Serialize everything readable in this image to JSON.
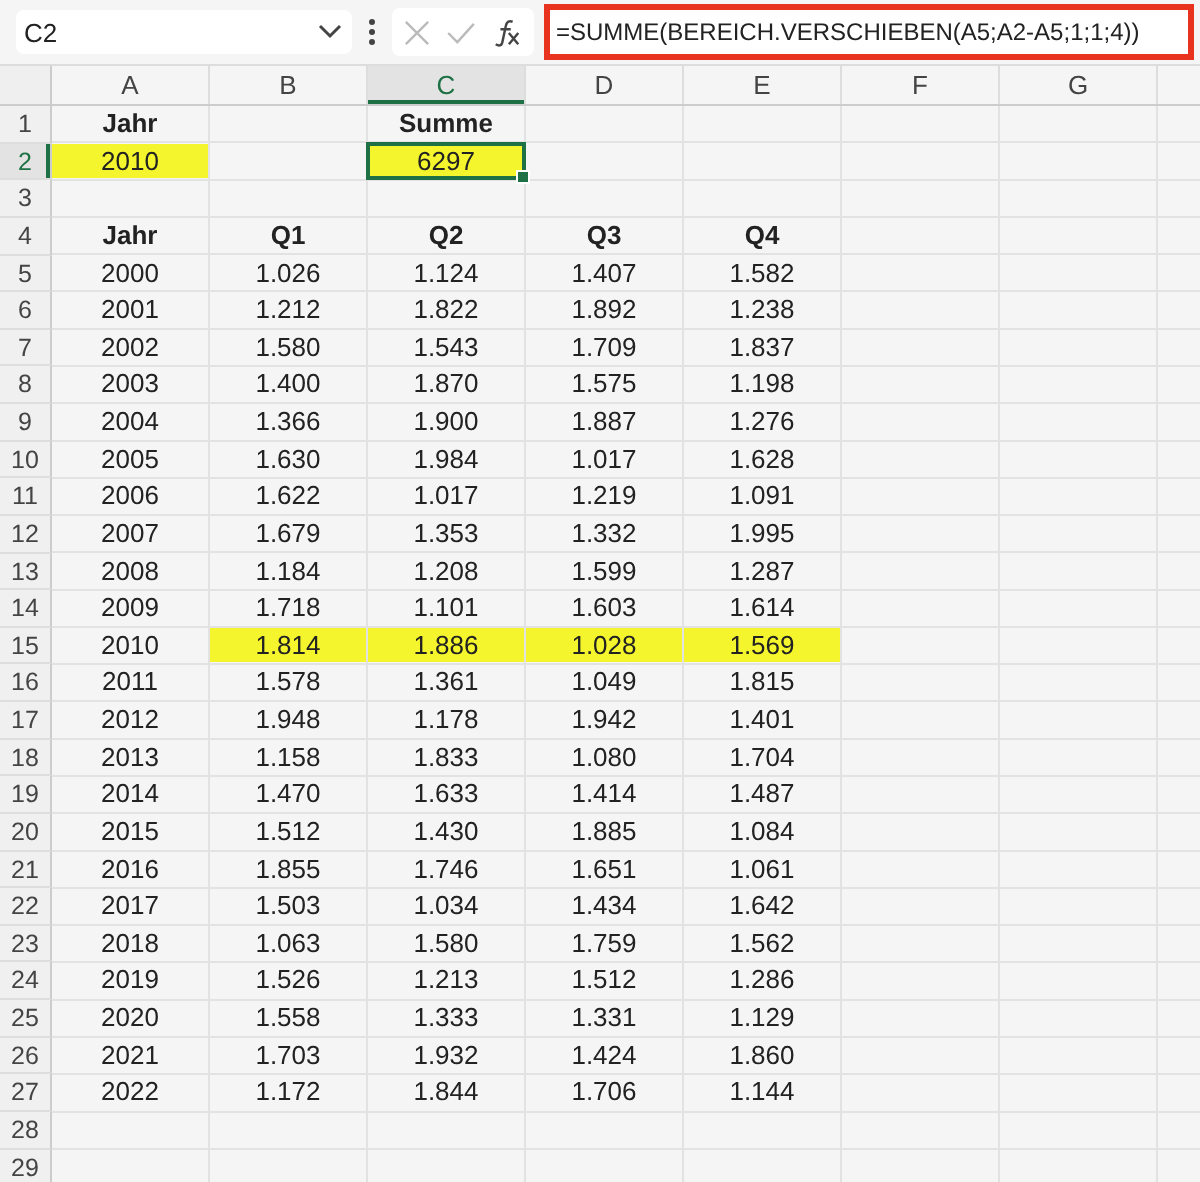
{
  "formula_bar": {
    "name_box": "C2",
    "formula": "=SUMME(BEREICH.VERSCHIEBEN(A5;A2-A5;1;1;4))",
    "outlined": true
  },
  "columns": [
    {
      "label": "A",
      "selected": false
    },
    {
      "label": "B",
      "selected": false
    },
    {
      "label": "C",
      "selected": true
    },
    {
      "label": "D",
      "selected": false
    },
    {
      "label": "E",
      "selected": false
    },
    {
      "label": "F",
      "selected": false
    },
    {
      "label": "G",
      "selected": false
    }
  ],
  "rows": [
    {
      "number": "1",
      "selected": false,
      "cells": [
        {
          "text": "Jahr",
          "bold": true,
          "highlighted": false,
          "selected": false
        },
        null,
        {
          "text": "Summe",
          "bold": true,
          "highlighted": false,
          "selected": false
        }
      ]
    },
    {
      "number": "2",
      "selected": true,
      "cells": [
        {
          "text": "2010",
          "bold": false,
          "highlighted": true,
          "selected": false
        },
        null,
        {
          "text": "6297",
          "bold": false,
          "highlighted": true,
          "selected": true
        }
      ]
    },
    {
      "number": "3",
      "selected": false
    },
    {
      "number": "4",
      "selected": false,
      "cells": [
        {
          "text": "Jahr",
          "bold": true,
          "highlighted": false,
          "selected": false
        },
        {
          "text": "Q1",
          "bold": true,
          "highlighted": false,
          "selected": false
        },
        {
          "text": "Q2",
          "bold": true,
          "highlighted": false,
          "selected": false
        },
        {
          "text": "Q3",
          "bold": true,
          "highlighted": false,
          "selected": false
        },
        {
          "text": "Q4",
          "bold": true,
          "highlighted": false,
          "selected": false
        }
      ]
    },
    {
      "number": "5",
      "selected": false,
      "cells": [
        {
          "text": "2000",
          "bold": false,
          "highlighted": false,
          "selected": false
        },
        {
          "text": "1.026",
          "bold": false,
          "highlighted": false,
          "selected": false
        },
        {
          "text": "1.124",
          "bold": false,
          "highlighted": false,
          "selected": false
        },
        {
          "text": "1.407",
          "bold": false,
          "highlighted": false,
          "selected": false
        },
        {
          "text": "1.582",
          "bold": false,
          "highlighted": false,
          "selected": false
        }
      ]
    },
    {
      "number": "6",
      "selected": false,
      "cells": [
        {
          "text": "2001",
          "bold": false,
          "highlighted": false,
          "selected": false
        },
        {
          "text": "1.212",
          "bold": false,
          "highlighted": false,
          "selected": false
        },
        {
          "text": "1.822",
          "bold": false,
          "highlighted": false,
          "selected": false
        },
        {
          "text": "1.892",
          "bold": false,
          "highlighted": false,
          "selected": false
        },
        {
          "text": "1.238",
          "bold": false,
          "highlighted": false,
          "selected": false
        }
      ]
    },
    {
      "number": "7",
      "selected": false,
      "cells": [
        {
          "text": "2002",
          "bold": false,
          "highlighted": false,
          "selected": false
        },
        {
          "text": "1.580",
          "bold": false,
          "highlighted": false,
          "selected": false
        },
        {
          "text": "1.543",
          "bold": false,
          "highlighted": false,
          "selected": false
        },
        {
          "text": "1.709",
          "bold": false,
          "highlighted": false,
          "selected": false
        },
        {
          "text": "1.837",
          "bold": false,
          "highlighted": false,
          "selected": false
        }
      ]
    },
    {
      "number": "8",
      "selected": false,
      "cells": [
        {
          "text": "2003",
          "bold": false,
          "highlighted": false,
          "selected": false
        },
        {
          "text": "1.400",
          "bold": false,
          "highlighted": false,
          "selected": false
        },
        {
          "text": "1.870",
          "bold": false,
          "highlighted": false,
          "selected": false
        },
        {
          "text": "1.575",
          "bold": false,
          "highlighted": false,
          "selected": false
        },
        {
          "text": "1.198",
          "bold": false,
          "highlighted": false,
          "selected": false
        }
      ]
    },
    {
      "number": "9",
      "selected": false,
      "cells": [
        {
          "text": "2004",
          "bold": false,
          "highlighted": false,
          "selected": false
        },
        {
          "text": "1.366",
          "bold": false,
          "highlighted": false,
          "selected": false
        },
        {
          "text": "1.900",
          "bold": false,
          "highlighted": false,
          "selected": false
        },
        {
          "text": "1.887",
          "bold": false,
          "highlighted": false,
          "selected": false
        },
        {
          "text": "1.276",
          "bold": false,
          "highlighted": false,
          "selected": false
        }
      ]
    },
    {
      "number": "10",
      "selected": false,
      "cells": [
        {
          "text": "2005",
          "bold": false,
          "highlighted": false,
          "selected": false
        },
        {
          "text": "1.630",
          "bold": false,
          "highlighted": false,
          "selected": false
        },
        {
          "text": "1.984",
          "bold": false,
          "highlighted": false,
          "selected": false
        },
        {
          "text": "1.017",
          "bold": false,
          "highlighted": false,
          "selected": false
        },
        {
          "text": "1.628",
          "bold": false,
          "highlighted": false,
          "selected": false
        }
      ]
    },
    {
      "number": "11",
      "selected": false,
      "cells": [
        {
          "text": "2006",
          "bold": false,
          "highlighted": false,
          "selected": false
        },
        {
          "text": "1.622",
          "bold": false,
          "highlighted": false,
          "selected": false
        },
        {
          "text": "1.017",
          "bold": false,
          "highlighted": false,
          "selected": false
        },
        {
          "text": "1.219",
          "bold": false,
          "highlighted": false,
          "selected": false
        },
        {
          "text": "1.091",
          "bold": false,
          "highlighted": false,
          "selected": false
        }
      ]
    },
    {
      "number": "12",
      "selected": false,
      "cells": [
        {
          "text": "2007",
          "bold": false,
          "highlighted": false,
          "selected": false
        },
        {
          "text": "1.679",
          "bold": false,
          "highlighted": false,
          "selected": false
        },
        {
          "text": "1.353",
          "bold": false,
          "highlighted": false,
          "selected": false
        },
        {
          "text": "1.332",
          "bold": false,
          "highlighted": false,
          "selected": false
        },
        {
          "text": "1.995",
          "bold": false,
          "highlighted": false,
          "selected": false
        }
      ]
    },
    {
      "number": "13",
      "selected": false,
      "cells": [
        {
          "text": "2008",
          "bold": false,
          "highlighted": false,
          "selected": false
        },
        {
          "text": "1.184",
          "bold": false,
          "highlighted": false,
          "selected": false
        },
        {
          "text": "1.208",
          "bold": false,
          "highlighted": false,
          "selected": false
        },
        {
          "text": "1.599",
          "bold": false,
          "highlighted": false,
          "selected": false
        },
        {
          "text": "1.287",
          "bold": false,
          "highlighted": false,
          "selected": false
        }
      ]
    },
    {
      "number": "14",
      "selected": false,
      "cells": [
        {
          "text": "2009",
          "bold": false,
          "highlighted": false,
          "selected": false
        },
        {
          "text": "1.718",
          "bold": false,
          "highlighted": false,
          "selected": false
        },
        {
          "text": "1.101",
          "bold": false,
          "highlighted": false,
          "selected": false
        },
        {
          "text": "1.603",
          "bold": false,
          "highlighted": false,
          "selected": false
        },
        {
          "text": "1.614",
          "bold": false,
          "highlighted": false,
          "selected": false
        }
      ]
    },
    {
      "number": "15",
      "selected": false,
      "cells": [
        {
          "text": "2010",
          "bold": false,
          "highlighted": false,
          "selected": false
        },
        {
          "text": "1.814",
          "bold": false,
          "highlighted": true,
          "selected": false
        },
        {
          "text": "1.886",
          "bold": false,
          "highlighted": true,
          "selected": false
        },
        {
          "text": "1.028",
          "bold": false,
          "highlighted": true,
          "selected": false
        },
        {
          "text": "1.569",
          "bold": false,
          "highlighted": true,
          "selected": false
        }
      ]
    },
    {
      "number": "16",
      "selected": false,
      "cells": [
        {
          "text": "2011",
          "bold": false,
          "highlighted": false,
          "selected": false
        },
        {
          "text": "1.578",
          "bold": false,
          "highlighted": false,
          "selected": false
        },
        {
          "text": "1.361",
          "bold": false,
          "highlighted": false,
          "selected": false
        },
        {
          "text": "1.049",
          "bold": false,
          "highlighted": false,
          "selected": false
        },
        {
          "text": "1.815",
          "bold": false,
          "highlighted": false,
          "selected": false
        }
      ]
    },
    {
      "number": "17",
      "selected": false,
      "cells": [
        {
          "text": "2012",
          "bold": false,
          "highlighted": false,
          "selected": false
        },
        {
          "text": "1.948",
          "bold": false,
          "highlighted": false,
          "selected": false
        },
        {
          "text": "1.178",
          "bold": false,
          "highlighted": false,
          "selected": false
        },
        {
          "text": "1.942",
          "bold": false,
          "highlighted": false,
          "selected": false
        },
        {
          "text": "1.401",
          "bold": false,
          "highlighted": false,
          "selected": false
        }
      ]
    },
    {
      "number": "18",
      "selected": false,
      "cells": [
        {
          "text": "2013",
          "bold": false,
          "highlighted": false,
          "selected": false
        },
        {
          "text": "1.158",
          "bold": false,
          "highlighted": false,
          "selected": false
        },
        {
          "text": "1.833",
          "bold": false,
          "highlighted": false,
          "selected": false
        },
        {
          "text": "1.080",
          "bold": false,
          "highlighted": false,
          "selected": false
        },
        {
          "text": "1.704",
          "bold": false,
          "highlighted": false,
          "selected": false
        }
      ]
    },
    {
      "number": "19",
      "selected": false,
      "cells": [
        {
          "text": "2014",
          "bold": false,
          "highlighted": false,
          "selected": false
        },
        {
          "text": "1.470",
          "bold": false,
          "highlighted": false,
          "selected": false
        },
        {
          "text": "1.633",
          "bold": false,
          "highlighted": false,
          "selected": false
        },
        {
          "text": "1.414",
          "bold": false,
          "highlighted": false,
          "selected": false
        },
        {
          "text": "1.487",
          "bold": false,
          "highlighted": false,
          "selected": false
        }
      ]
    },
    {
      "number": "20",
      "selected": false,
      "cells": [
        {
          "text": "2015",
          "bold": false,
          "highlighted": false,
          "selected": false
        },
        {
          "text": "1.512",
          "bold": false,
          "highlighted": false,
          "selected": false
        },
        {
          "text": "1.430",
          "bold": false,
          "highlighted": false,
          "selected": false
        },
        {
          "text": "1.885",
          "bold": false,
          "highlighted": false,
          "selected": false
        },
        {
          "text": "1.084",
          "bold": false,
          "highlighted": false,
          "selected": false
        }
      ]
    },
    {
      "number": "21",
      "selected": false,
      "cells": [
        {
          "text": "2016",
          "bold": false,
          "highlighted": false,
          "selected": false
        },
        {
          "text": "1.855",
          "bold": false,
          "highlighted": false,
          "selected": false
        },
        {
          "text": "1.746",
          "bold": false,
          "highlighted": false,
          "selected": false
        },
        {
          "text": "1.651",
          "bold": false,
          "highlighted": false,
          "selected": false
        },
        {
          "text": "1.061",
          "bold": false,
          "highlighted": false,
          "selected": false
        }
      ]
    },
    {
      "number": "22",
      "selected": false,
      "cells": [
        {
          "text": "2017",
          "bold": false,
          "highlighted": false,
          "selected": false
        },
        {
          "text": "1.503",
          "bold": false,
          "highlighted": false,
          "selected": false
        },
        {
          "text": "1.034",
          "bold": false,
          "highlighted": false,
          "selected": false
        },
        {
          "text": "1.434",
          "bold": false,
          "highlighted": false,
          "selected": false
        },
        {
          "text": "1.642",
          "bold": false,
          "highlighted": false,
          "selected": false
        }
      ]
    },
    {
      "number": "23",
      "selected": false,
      "cells": [
        {
          "text": "2018",
          "bold": false,
          "highlighted": false,
          "selected": false
        },
        {
          "text": "1.063",
          "bold": false,
          "highlighted": false,
          "selected": false
        },
        {
          "text": "1.580",
          "bold": false,
          "highlighted": false,
          "selected": false
        },
        {
          "text": "1.759",
          "bold": false,
          "highlighted": false,
          "selected": false
        },
        {
          "text": "1.562",
          "bold": false,
          "highlighted": false,
          "selected": false
        }
      ]
    },
    {
      "number": "24",
      "selected": false,
      "cells": [
        {
          "text": "2019",
          "bold": false,
          "highlighted": false,
          "selected": false
        },
        {
          "text": "1.526",
          "bold": false,
          "highlighted": false,
          "selected": false
        },
        {
          "text": "1.213",
          "bold": false,
          "highlighted": false,
          "selected": false
        },
        {
          "text": "1.512",
          "bold": false,
          "highlighted": false,
          "selected": false
        },
        {
          "text": "1.286",
          "bold": false,
          "highlighted": false,
          "selected": false
        }
      ]
    },
    {
      "number": "25",
      "selected": false,
      "cells": [
        {
          "text": "2020",
          "bold": false,
          "highlighted": false,
          "selected": false
        },
        {
          "text": "1.558",
          "bold": false,
          "highlighted": false,
          "selected": false
        },
        {
          "text": "1.333",
          "bold": false,
          "highlighted": false,
          "selected": false
        },
        {
          "text": "1.331",
          "bold": false,
          "highlighted": false,
          "selected": false
        },
        {
          "text": "1.129",
          "bold": false,
          "highlighted": false,
          "selected": false
        }
      ]
    },
    {
      "number": "26",
      "selected": false,
      "cells": [
        {
          "text": "2021",
          "bold": false,
          "highlighted": false,
          "selected": false
        },
        {
          "text": "1.703",
          "bold": false,
          "highlighted": false,
          "selected": false
        },
        {
          "text": "1.932",
          "bold": false,
          "highlighted": false,
          "selected": false
        },
        {
          "text": "1.424",
          "bold": false,
          "highlighted": false,
          "selected": false
        },
        {
          "text": "1.860",
          "bold": false,
          "highlighted": false,
          "selected": false
        }
      ]
    },
    {
      "number": "27",
      "selected": false,
      "cells": [
        {
          "text": "2022",
          "bold": false,
          "highlighted": false,
          "selected": false
        },
        {
          "text": "1.172",
          "bold": false,
          "highlighted": false,
          "selected": false
        },
        {
          "text": "1.844",
          "bold": false,
          "highlighted": false,
          "selected": false
        },
        {
          "text": "1.706",
          "bold": false,
          "highlighted": false,
          "selected": false
        },
        {
          "text": "1.144",
          "bold": false,
          "highlighted": false,
          "selected": false
        }
      ]
    },
    {
      "number": "28",
      "selected": false
    },
    {
      "number": "29",
      "selected": false
    }
  ]
}
